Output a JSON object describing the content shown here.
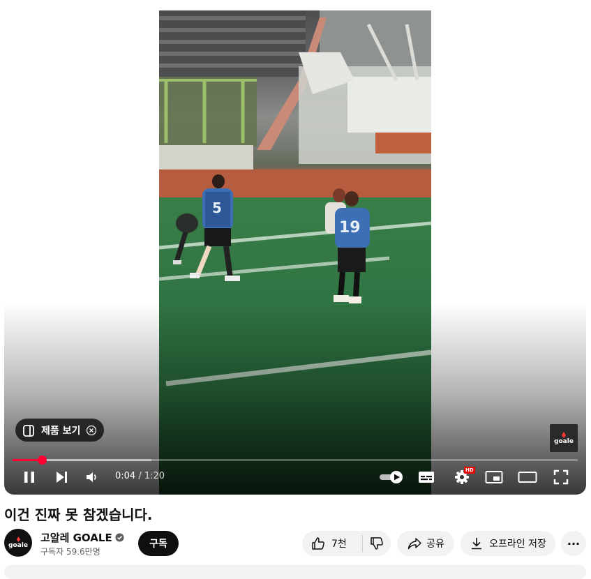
{
  "player": {
    "product_chip_label": "제품 보기",
    "watermark_text": "goale",
    "time_current": "0:04",
    "time_separator": " / ",
    "time_total": "1:20",
    "progress_played_fraction": 0.052,
    "progress_buffered_fraction": 0.246,
    "settings_badge": "HD",
    "jersey_numbers": [
      "5",
      "19"
    ],
    "controls": {
      "play_pause_icon": "pause-icon",
      "next_icon": "next-icon",
      "volume_icon": "volume-icon",
      "autoplay_icon": "autoplay-toggle-icon",
      "captions_icon": "captions-icon",
      "settings_icon": "settings-gear-icon",
      "miniplayer_icon": "miniplayer-icon",
      "theater_icon": "theater-mode-icon",
      "fullscreen_icon": "fullscreen-icon"
    }
  },
  "video": {
    "title": "이건 진짜 못 참겠습니다."
  },
  "channel": {
    "avatar_text": "goale",
    "name": "고알레 GOALE",
    "subscribers": "구독자 59.6만명",
    "subscribe_label": "구독"
  },
  "actions": {
    "like_count": "7천",
    "share_label": "공유",
    "download_label": "오프라인 저장",
    "more_label": "···"
  },
  "colors": {
    "accent_red": "#ff0033",
    "button_dark": "#0f0f0f",
    "pill_bg": "#f2f2f2"
  }
}
